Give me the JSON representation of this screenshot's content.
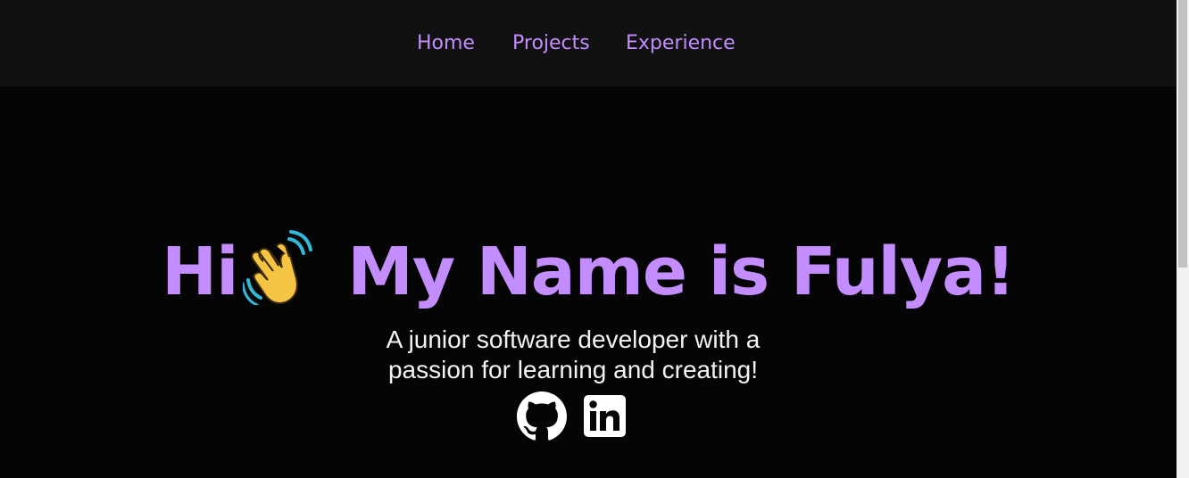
{
  "nav": {
    "items": [
      {
        "label": "Home"
      },
      {
        "label": "Projects"
      },
      {
        "label": "Experience"
      }
    ]
  },
  "hero": {
    "greeting": "Hi",
    "name_line": "My Name is Fulya!",
    "subtitle_line1": "A junior software developer with a",
    "subtitle_line2": "passion for learning and creating!"
  },
  "icons": {
    "wave": "waving-hand-icon",
    "github": "github-icon",
    "linkedin": "linkedin-icon"
  },
  "colors": {
    "accent": "#c38dfd",
    "nav_background": "#111111",
    "page_background": "#050505",
    "text": "#f2f2f2"
  }
}
